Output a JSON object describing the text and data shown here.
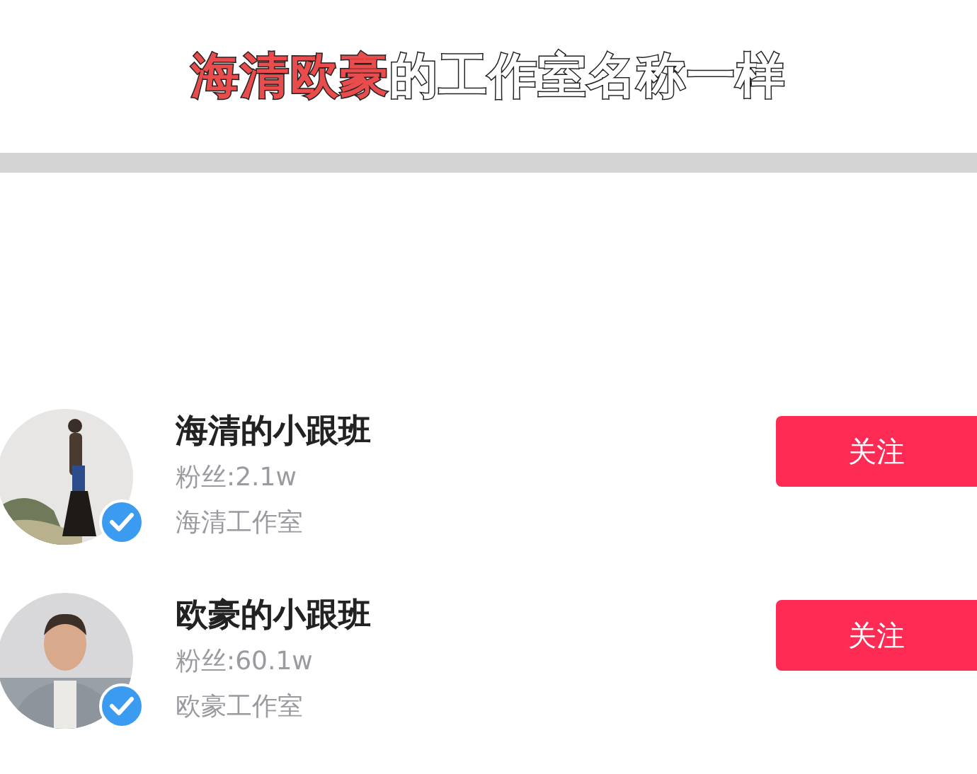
{
  "caption": [
    {
      "text": "海清欧豪",
      "highlight": true
    },
    {
      "text": "的工作室名称一样",
      "highlight": false
    }
  ],
  "accounts": [
    {
      "kind": "picture",
      "name": "海清的小跟班",
      "fans": "粉丝:2.1w",
      "studio": "海清工作室",
      "verified": true,
      "follow": "关注"
    },
    {
      "kind": "picture",
      "name": "欧豪的小跟班",
      "fans": "粉丝:60.1w",
      "studio": "欧豪工作室",
      "verified": true,
      "follow": "关注"
    }
  ]
}
